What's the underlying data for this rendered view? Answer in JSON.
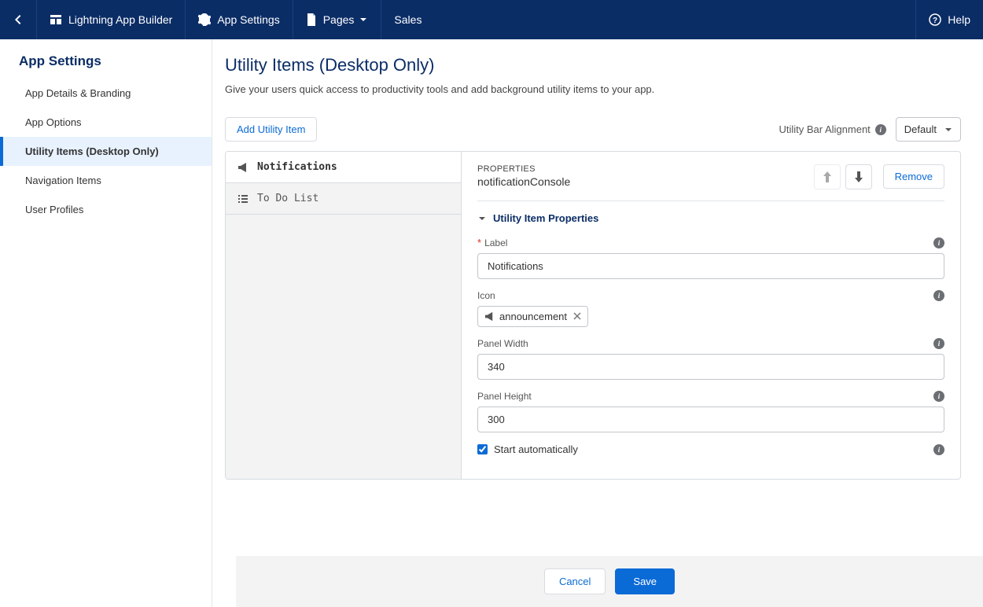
{
  "topbar": {
    "builder": "Lightning App Builder",
    "app_settings": "App Settings",
    "pages": "Pages",
    "context": "Sales",
    "help": "Help"
  },
  "sidebar": {
    "title": "App Settings",
    "items": [
      {
        "label": "App Details & Branding"
      },
      {
        "label": "App Options"
      },
      {
        "label": "Utility Items (Desktop Only)"
      },
      {
        "label": "Navigation Items"
      },
      {
        "label": "User Profiles"
      }
    ]
  },
  "page": {
    "title": "Utility Items (Desktop Only)",
    "description": "Give your users quick access to productivity tools and add background utility items to your app."
  },
  "toolbar": {
    "add_label": "Add Utility Item",
    "alignment_label": "Utility Bar Alignment",
    "alignment_value": "Default"
  },
  "items": [
    {
      "label": "Notifications",
      "selected": true
    },
    {
      "label": "To Do List",
      "selected": false
    }
  ],
  "properties": {
    "super": "PROPERTIES",
    "name": "notificationConsole",
    "remove": "Remove",
    "section_title": "Utility Item Properties",
    "label_field": {
      "label": "Label",
      "value": "Notifications",
      "required": true
    },
    "icon_field": {
      "label": "Icon",
      "value": "announcement"
    },
    "panel_width": {
      "label": "Panel Width",
      "value": "340"
    },
    "panel_height": {
      "label": "Panel Height",
      "value": "300"
    },
    "start_auto": {
      "label": "Start automatically",
      "checked": true
    }
  },
  "footer": {
    "cancel": "Cancel",
    "save": "Save"
  }
}
